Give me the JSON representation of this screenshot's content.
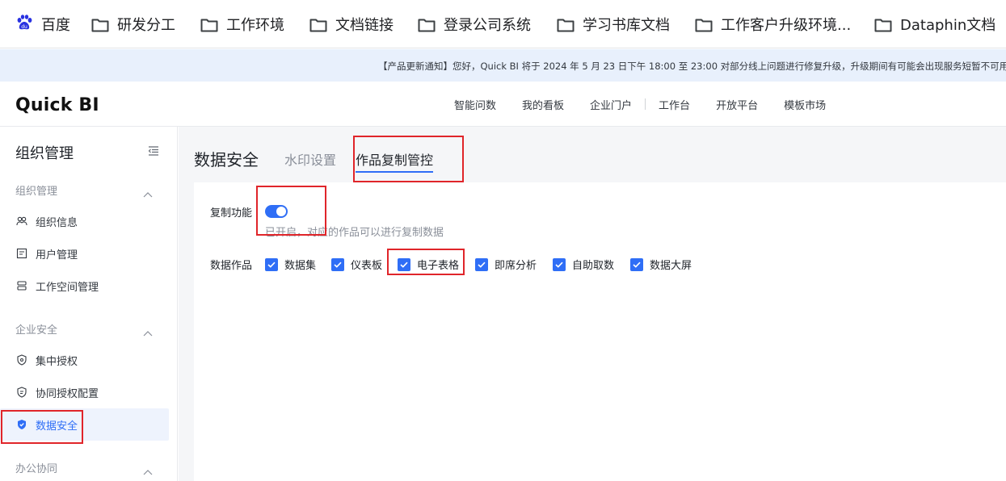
{
  "bookmarks": {
    "items": [
      {
        "label": "百度",
        "icon": "baidu-paw-icon"
      },
      {
        "label": "研发分工",
        "icon": "folder-icon"
      },
      {
        "label": "工作环境",
        "icon": "folder-icon"
      },
      {
        "label": "文档链接",
        "icon": "folder-icon"
      },
      {
        "label": "登录公司系统",
        "icon": "folder-icon"
      },
      {
        "label": "学习书库文档",
        "icon": "folder-icon"
      },
      {
        "label": "工作客户升级环境...",
        "icon": "folder-icon"
      },
      {
        "label": "Dataphin文档",
        "icon": "folder-icon"
      }
    ]
  },
  "notice": {
    "text": "【产品更新通知】您好，Quick BI 将于 2024 年 5 月 23 日下午 18:00 至 23:00 对部分线上问题进行修复升级，升级期间有可能会出现服务短暂不可用"
  },
  "topnav": {
    "logo": "Quick BI",
    "links": [
      "智能问数",
      "我的看板",
      "企业门户",
      "工作台",
      "开放平台",
      "模板市场"
    ]
  },
  "sidebar": {
    "title": "组织管理",
    "groups": [
      {
        "label": "组织管理",
        "items": [
          {
            "label": "组织信息",
            "icon": "organization-icon"
          },
          {
            "label": "用户管理",
            "icon": "user-card-icon"
          },
          {
            "label": "工作空间管理",
            "icon": "workspace-icon"
          }
        ]
      },
      {
        "label": "企业安全",
        "items": [
          {
            "label": "集中授权",
            "icon": "shield-icon"
          },
          {
            "label": "协同授权配置",
            "icon": "shield-settings-icon"
          },
          {
            "label": "数据安全",
            "icon": "shield-check-icon"
          }
        ]
      },
      {
        "label": "办公协同",
        "items": []
      }
    ]
  },
  "main": {
    "page_title": "数据安全",
    "tabs": [
      "水印设置",
      "作品复制管控"
    ],
    "active_tab": "作品复制管控",
    "copy_function": {
      "label": "复制功能",
      "enabled": true,
      "hint": "已开启，对应的作品可以进行复制数据"
    },
    "data_works": {
      "label": "数据作品",
      "options": [
        {
          "label": "数据集",
          "checked": true
        },
        {
          "label": "仪表板",
          "checked": true
        },
        {
          "label": "电子表格",
          "checked": true
        },
        {
          "label": "即席分析",
          "checked": true
        },
        {
          "label": "自助取数",
          "checked": true
        },
        {
          "label": "数据大屏",
          "checked": true
        }
      ]
    }
  },
  "colors": {
    "accent": "#2f6ef6",
    "annotation": "#e0252a",
    "notice_bg": "#e8f0fc",
    "main_bg": "#f5f6f8"
  }
}
